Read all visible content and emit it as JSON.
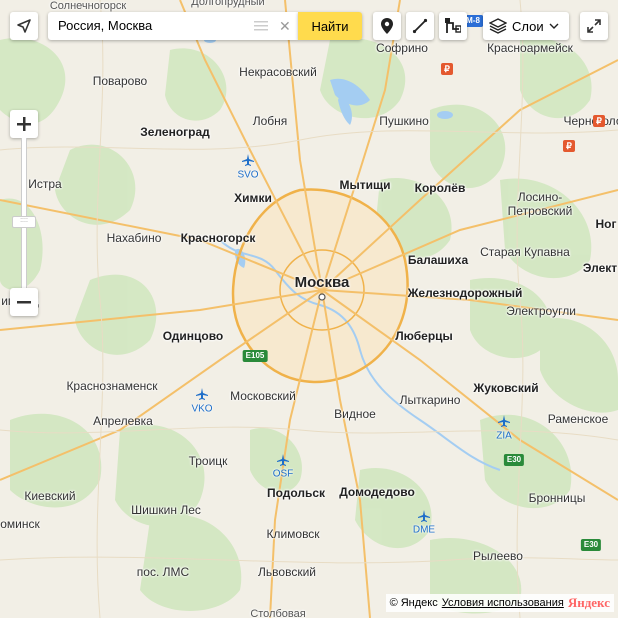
{
  "search": {
    "value": "Россия, Москва",
    "button_label": "Найти"
  },
  "toolbar": {
    "layers_label": "Слои"
  },
  "footer": {
    "copyright": "© Яндекс",
    "terms": "Условия использования",
    "logo": "Яндекс"
  },
  "icons": [
    "geolocation-icon",
    "menu-icon",
    "close-icon",
    "pin-icon",
    "ruler-icon",
    "route-icon",
    "layers-icon",
    "chevron-down-icon",
    "fullscreen-icon",
    "plus-icon",
    "minus-icon",
    "airport-icon",
    "railway-icon"
  ],
  "labels": {
    "solnechnogorsk": "Солнечногорск",
    "dolgoprudny_top": "Долгопрудный",
    "sofrino": "Софрино",
    "krasnoarmeysk": "Красноармейск",
    "povarovo": "Поварово",
    "nekrasovsky": "Некрасовский",
    "zelenograd": "Зеленоград",
    "lobnya": "Лобня",
    "pushkino": "Пушкино",
    "chernogolovka": "Черноголо",
    "svo_code": "SVO",
    "istra": "Истра",
    "khimki": "Химки",
    "mytishchi": "Мытищи",
    "korolyov": "Королёв",
    "losino": "Лосино-\nПетровский",
    "nakhabino": "Нахабино",
    "krasnogorsk": "Красногорск",
    "staraya_kupavna": "Старая Купавна",
    "noginsk": "Ног",
    "balashikha": "Балашиха",
    "elektrostal": "Элект",
    "moskva": "Москва",
    "zheleznodorozhny": "Железнодорожный",
    "elektrougli": "Электроугли",
    "zvenigorod": "игород",
    "odintsovo": "Одинцово",
    "lyubertsy": "Люберцы",
    "e105": "E105",
    "krasnoznamensk": "Краснознаменск",
    "zhukovsky": "Жуковский",
    "vko_code": "VKO",
    "moskovsky": "Московский",
    "aprelevka": "Апрелевка",
    "vidnoe": "Видное",
    "lytkarino": "Лыткарино",
    "ramenskoe": "Раменское",
    "zia_code": "ZIA",
    "troitsk": "Троицк",
    "e30_a": "E30",
    "osf_code": "OSF",
    "kievsky": "Киевский",
    "podolsk": "Подольск",
    "domodedovo": "Домодедово",
    "bronnitsy": "Бронницы",
    "shishkin_les": "Шишкин Лес",
    "dme_code": "DME",
    "klimovsk": "Климовск",
    "naro": "оминск",
    "lms": "пос. ЛМС",
    "ryleevo": "Рылеево",
    "e30_b": "E30",
    "lvovsky": "Львовский",
    "stolbovaya": "Столбовая",
    "m8": "М-8"
  },
  "colors": {
    "search_button": "#ffdb4d",
    "water": "#a4cdf2",
    "forest": "#d4e9c4",
    "road_major": "#f9c66b",
    "airport": "#1e6ec9",
    "railway_station": "#e4592f",
    "highway_badge": "#2a8a3a"
  }
}
